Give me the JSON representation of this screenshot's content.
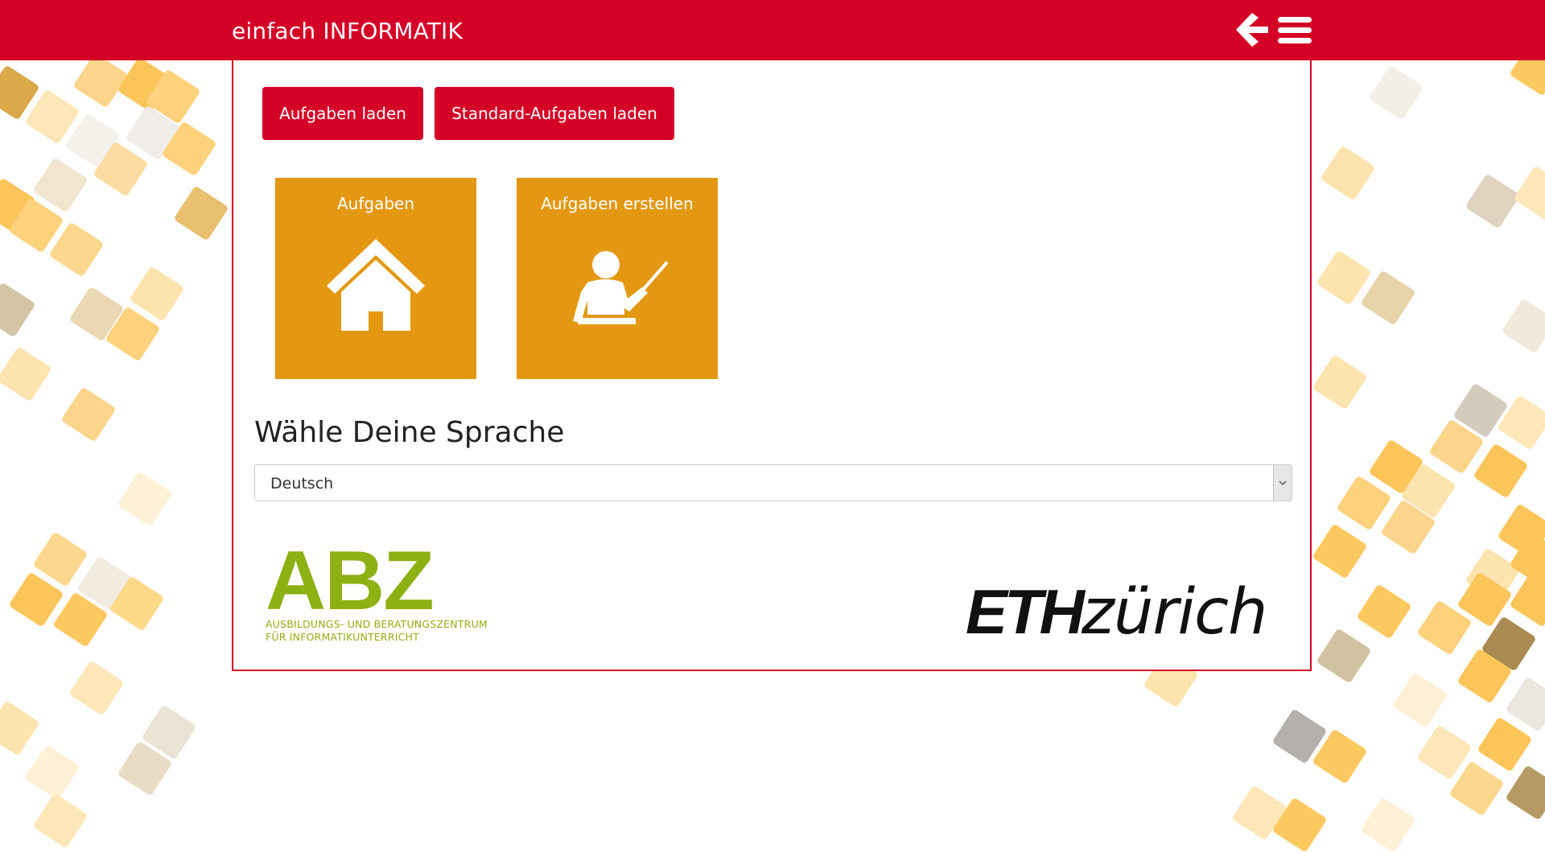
{
  "header": {
    "brand": "einfach INFORMATIK",
    "back_icon": "arrow-left-icon",
    "menu_icon": "hamburger-menu-icon"
  },
  "toolbar": {
    "load_label": "Aufgaben laden",
    "load_standard_label": "Standard-Aufgaben laden"
  },
  "tiles": [
    {
      "label": "Aufgaben",
      "icon": "house-icon"
    },
    {
      "label": "Aufgaben erstellen",
      "icon": "teacher-icon"
    }
  ],
  "language": {
    "heading": "Wähle Deine Sprache",
    "selected": "Deutsch"
  },
  "logos": {
    "abz_title": "ABZ",
    "abz_line1": "AUSBILDUNGS- UND BERATUNGSZENTRUM",
    "abz_line2": "FÜR INFORMATIKUNTERRICHT",
    "eth_bold": "ETH",
    "eth_light": "zürich"
  },
  "colors": {
    "brand_red": "#d50026",
    "tile_orange": "#e49812",
    "abz_green": "#8db013"
  }
}
